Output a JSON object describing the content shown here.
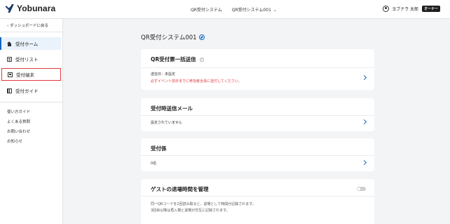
{
  "header": {
    "logo_text": "Yobunara",
    "nav_system": "QR受付システム",
    "nav_current": "QR受付システム001",
    "user_name": "ヨブナラ 太郎",
    "owner_badge": "オーナー"
  },
  "sidebar": {
    "back_label": "ダッシュボードに戻る",
    "items": [
      {
        "label": "受付ホーム",
        "icon": "home-icon",
        "active": true
      },
      {
        "label": "受付リスト",
        "icon": "list-icon",
        "active": false
      },
      {
        "label": "受付端末",
        "icon": "terminal-icon",
        "active": false
      },
      {
        "label": "受付ガイド",
        "icon": "guide-icon",
        "active": false
      }
    ],
    "links": [
      "使い方ガイド",
      "よくある質問",
      "お問い合わせ",
      "お知らせ"
    ]
  },
  "main": {
    "page_title": "QR受付システム001",
    "cards": {
      "bulk_send": {
        "title": "QR受付票一括送信",
        "status": "送信日：未設定",
        "warning": "必ずイベント前日までに参加者全員に送付してください。"
      },
      "reception_mail": {
        "title": "受付時送信メール",
        "status": "設定されていません"
      },
      "staff": {
        "title": "受付係",
        "count": "0名"
      },
      "exit_time": {
        "title": "ゲストの退場時間を管理",
        "desc1": "同一QRコードを2回読み取ると、退場として時間が記録されます。",
        "desc2": "3回目以降は再入場と退場が交互に記録されます。",
        "toggle_on": false
      }
    }
  },
  "colors": {
    "accent": "#1565c0",
    "warning": "#e0383e",
    "background": "#f3f4f6"
  }
}
